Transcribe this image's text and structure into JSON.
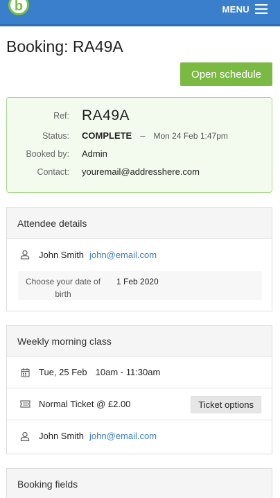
{
  "header": {
    "logo_letter": "b",
    "menu_label": "MENU"
  },
  "page": {
    "title": "Booking: RA49A",
    "open_schedule_label": "Open schedule"
  },
  "summary": {
    "ref_label": "Ref:",
    "ref_value": "RA49A",
    "status_label": "Status:",
    "status_value": "COMPLETE",
    "status_dash": "–",
    "status_date": "Mon 24 Feb 1:47pm",
    "booked_by_label": "Booked by:",
    "booked_by_value": "Admin",
    "contact_label": "Contact:",
    "contact_value": "youremail@addresshere.com"
  },
  "attendee": {
    "header": "Attendee details",
    "name": "John Smith",
    "email": "john@email.com",
    "dob_label": "Choose your date of birth",
    "dob_value": "1 Feb 2020"
  },
  "class": {
    "header": "Weekly morning class",
    "date": "Tue, 25 Feb",
    "time": "10am - 11:30am",
    "ticket": "Normal Ticket @ £2.00",
    "ticket_options_label": "Ticket options",
    "attendee_name": "John Smith",
    "attendee_email": "john@email.com"
  },
  "booking_fields": {
    "header": "Booking fields"
  },
  "colors": {
    "topbar": "#3a7fcb",
    "accent_green": "#7ab942",
    "link": "#3b7dc4",
    "summary_bg": "#f3fbee",
    "summary_border": "#a9d98a"
  },
  "icons": {
    "person": "person-icon",
    "calendar": "calendar-icon",
    "ticket": "ticket-icon",
    "menu": "hamburger-icon",
    "logo": "brand-logo"
  }
}
